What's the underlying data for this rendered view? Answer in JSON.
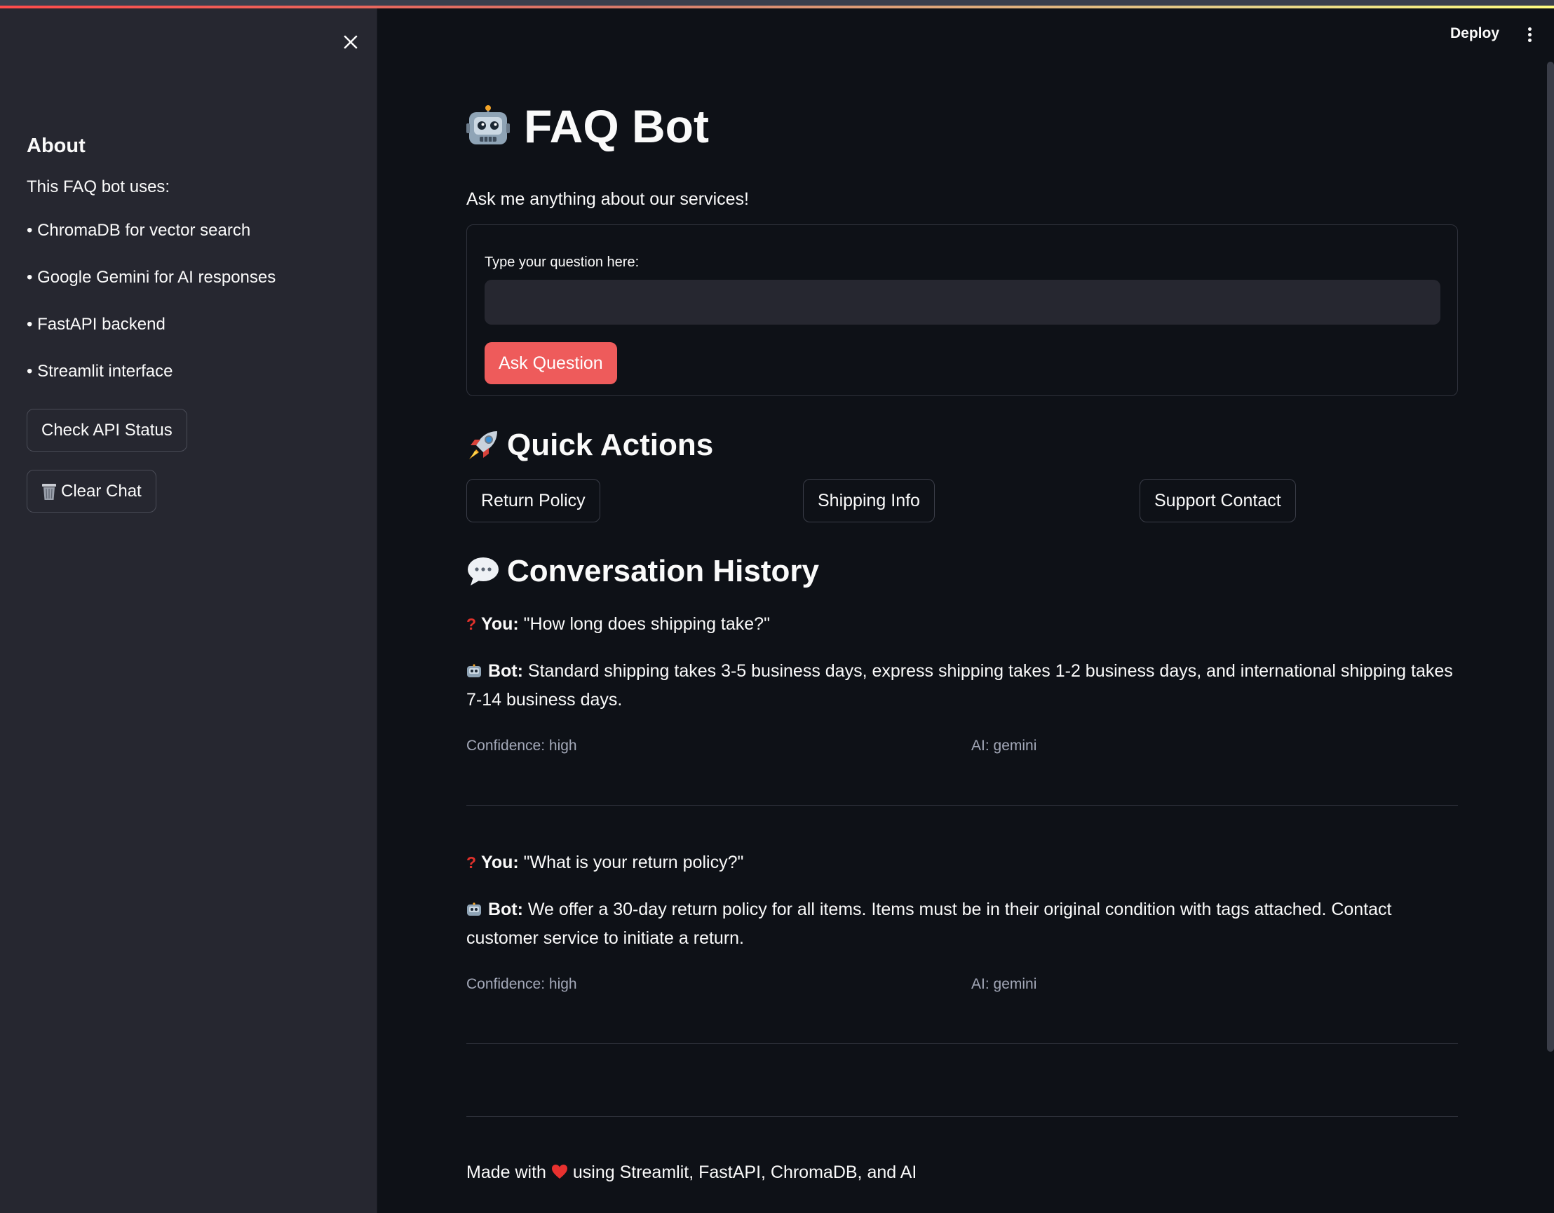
{
  "header": {
    "deploy_label": "Deploy"
  },
  "sidebar": {
    "about_title": "About",
    "intro": "This FAQ bot uses:",
    "items": [
      {
        "label": "• ChromaDB for vector search"
      },
      {
        "label": "• Google Gemini for AI responses"
      },
      {
        "label": "• FastAPI backend"
      },
      {
        "label": "• Streamlit interface"
      }
    ],
    "check_api_label": "Check API Status",
    "clear_chat_label": "Clear Chat",
    "clear_chat_icon": "wastebasket-icon"
  },
  "main": {
    "title": "FAQ Bot",
    "title_icon": "robot-icon",
    "subtitle": "Ask me anything about our services!",
    "form": {
      "label": "Type your question here:",
      "value": "",
      "placeholder": "",
      "submit_label": "Ask Question"
    },
    "quick_actions": {
      "title": "Quick Actions",
      "icon": "rocket-icon",
      "buttons": [
        {
          "label": "Return Policy"
        },
        {
          "label": "Shipping Info"
        },
        {
          "label": "Support Contact"
        }
      ]
    },
    "history": {
      "title": "Conversation History",
      "icon": "speech-bubble-icon",
      "entries": [
        {
          "you_label": "You:",
          "question": "\"How long does shipping take?\"",
          "bot_label": "Bot:",
          "answer": "Standard shipping takes 3-5 business days, express shipping takes 1-2 business days, and international shipping takes 7-14 business days.",
          "confidence": "Confidence: high",
          "ai": "AI: gemini"
        },
        {
          "you_label": "You:",
          "question": "\"What is your return policy?\"",
          "bot_label": "Bot:",
          "answer": "We offer a 30-day return policy for all items. Items must be in their original condition with tags attached. Contact customer service to initiate a return.",
          "confidence": "Confidence: high",
          "ai": "AI: gemini"
        }
      ]
    },
    "footer": {
      "before": "Made with",
      "after": "using Streamlit, FastAPI, ChromaDB, and AI"
    }
  },
  "colors": {
    "background": "#0e1117",
    "sidebar": "#262730",
    "primary_button": "#ee5b5b",
    "text": "#fafafa",
    "muted_text": "#a3a8b8"
  }
}
